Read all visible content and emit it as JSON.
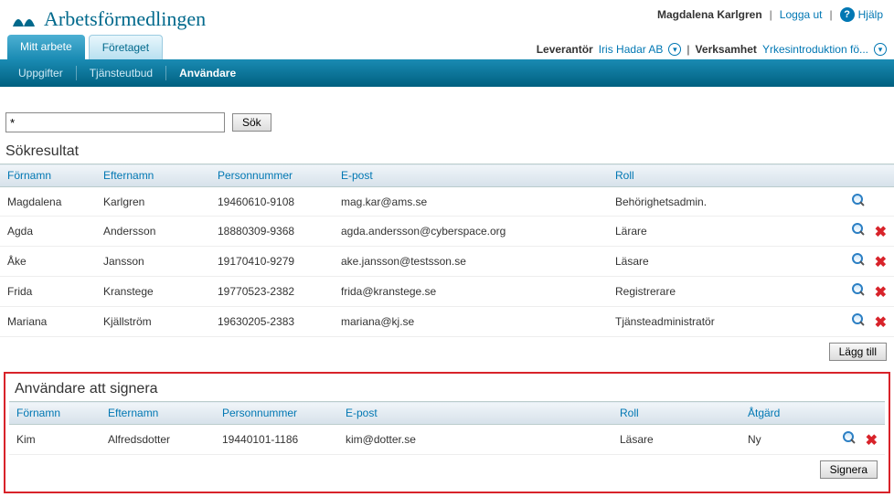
{
  "brand": "Arbetsförmedlingen",
  "user_bar": {
    "user_name": "Magdalena Karlgren",
    "logout_label": "Logga ut",
    "help_label": "Hjälp"
  },
  "tabs": {
    "mitt_arbete": "Mitt arbete",
    "foretaget": "Företaget"
  },
  "context": {
    "leverantor_label": "Leverantör",
    "leverantor_value": "Iris Hadar AB",
    "verksamhet_label": "Verksamhet",
    "verksamhet_value": "Yrkesintroduktion fö..."
  },
  "subnav": {
    "uppgifter": "Uppgifter",
    "tjansteutbud": "Tjänsteutbud",
    "anvandare": "Användare"
  },
  "search": {
    "value": "*",
    "button": "Sök"
  },
  "results": {
    "title": "Sökresultat",
    "headers": {
      "fornamn": "Förnamn",
      "efternamn": "Efternamn",
      "personnummer": "Personnummer",
      "epost": "E-post",
      "roll": "Roll"
    },
    "rows": [
      {
        "fornamn": "Magdalena",
        "efternamn": "Karlgren",
        "pn": "19460610-9108",
        "epost": "mag.kar@ams.se",
        "roll": "Behörighetsadmin.",
        "deletable": false
      },
      {
        "fornamn": "Agda",
        "efternamn": "Andersson",
        "pn": "18880309-9368",
        "epost": "agda.andersson@cyberspace.org",
        "roll": "Lärare",
        "deletable": true
      },
      {
        "fornamn": "Åke",
        "efternamn": "Jansson",
        "pn": "19170410-9279",
        "epost": "ake.jansson@testsson.se",
        "roll": "Läsare",
        "deletable": true
      },
      {
        "fornamn": "Frida",
        "efternamn": "Kranstege",
        "pn": "19770523-2382",
        "epost": "frida@kranstege.se",
        "roll": "Registrerare",
        "deletable": true
      },
      {
        "fornamn": "Mariana",
        "efternamn": "Kjällström",
        "pn": "19630205-2383",
        "epost": "mariana@kj.se",
        "roll": "Tjänsteadministratör",
        "deletable": true
      }
    ],
    "add_button": "Lägg till"
  },
  "sign": {
    "title": "Användare att signera",
    "headers": {
      "fornamn": "Förnamn",
      "efternamn": "Efternamn",
      "personnummer": "Personnummer",
      "epost": "E-post",
      "roll": "Roll",
      "atgard": "Åtgärd"
    },
    "rows": [
      {
        "fornamn": "Kim",
        "efternamn": "Alfredsdotter",
        "pn": "19440101-1186",
        "epost": "kim@dotter.se",
        "roll": "Läsare",
        "atgard": "Ny"
      }
    ],
    "sign_button": "Signera"
  }
}
